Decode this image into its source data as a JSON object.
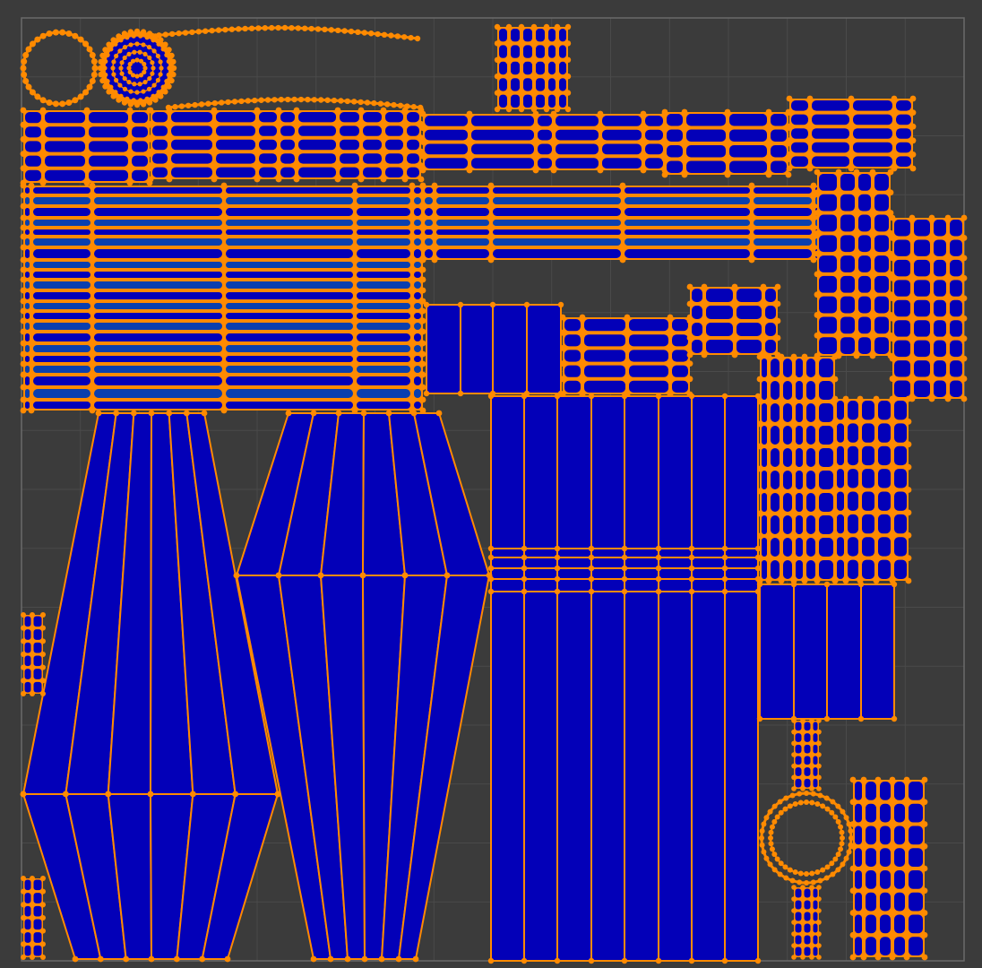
{
  "editor": {
    "view": "uv-editor",
    "background_color": "#3b3b3b",
    "grid_color": "#4a4a4a",
    "grid_divisions": 16,
    "uv_boundary_color": "#6a6a6a"
  },
  "mesh_style": {
    "face_fill_color": "#0300b8",
    "face_fill_alt_color": "#0a3fae",
    "edge_color": "#ff8a00",
    "vertex_color": "#ff8a00",
    "selection": "all-faces-selected"
  }
}
